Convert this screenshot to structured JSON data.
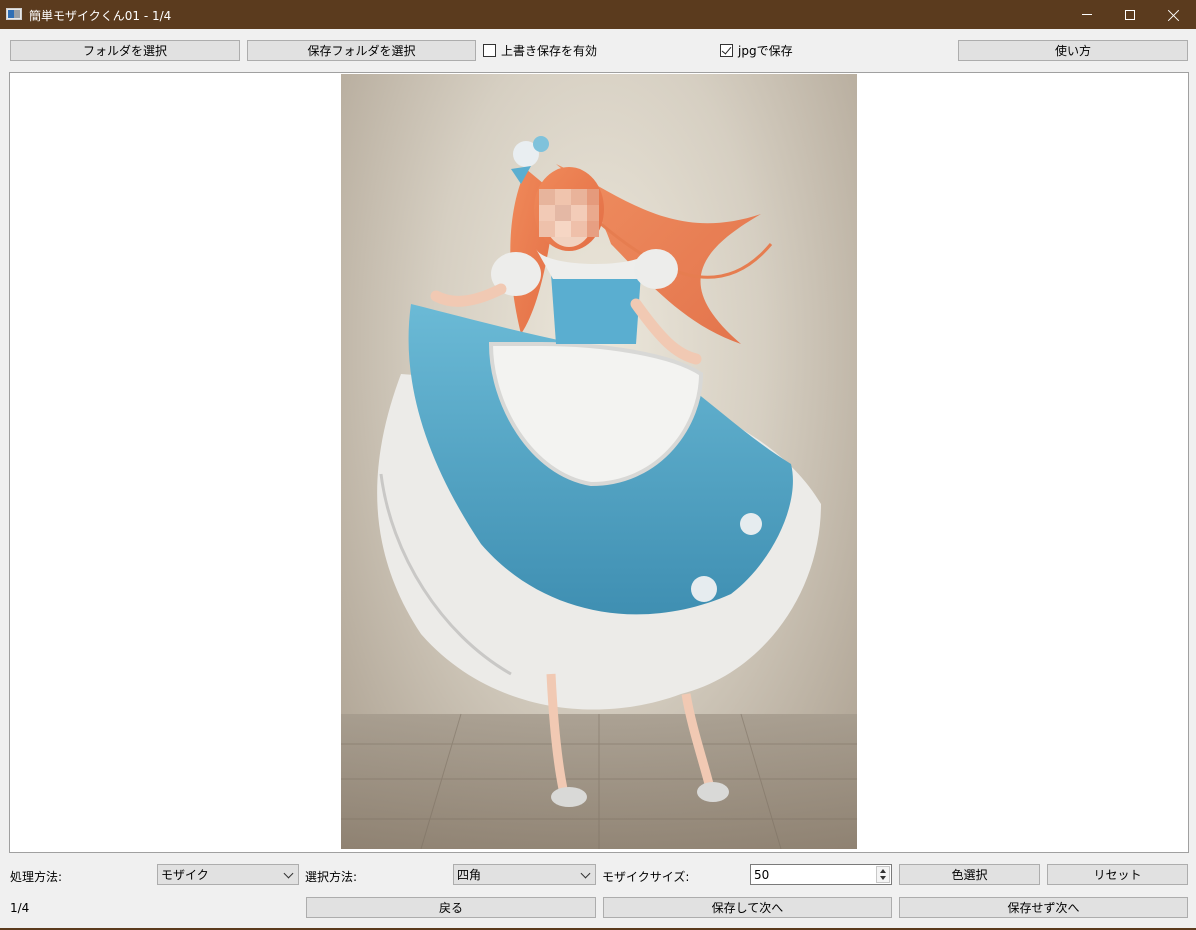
{
  "window": {
    "title": "簡単モザイクくん01 - 1/4"
  },
  "toolbar": {
    "select_folder_label": "フォルダを選択",
    "select_save_folder_label": "保存フォルダを選択",
    "overwrite_label": "上書き保存を有効",
    "overwrite_checked": false,
    "jpg_label": "jpgで保存",
    "jpg_checked": true,
    "help_label": "使い方"
  },
  "controls": {
    "process_method_label": "処理方法:",
    "process_method_value": "モザイク",
    "select_method_label": "選択方法:",
    "select_method_value": "四角",
    "mosaic_size_label": "モザイクサイズ:",
    "mosaic_size_value": "50",
    "color_select_label": "色選択",
    "reset_label": "リセット"
  },
  "footer": {
    "page_counter": "1/4",
    "back_label": "戻る",
    "save_next_label": "保存して次へ",
    "skip_next_label": "保存せず次へ"
  },
  "colors": {
    "titlebar": "#5b3b1e",
    "button_face": "#e1e1e1",
    "button_border": "#adadad"
  }
}
